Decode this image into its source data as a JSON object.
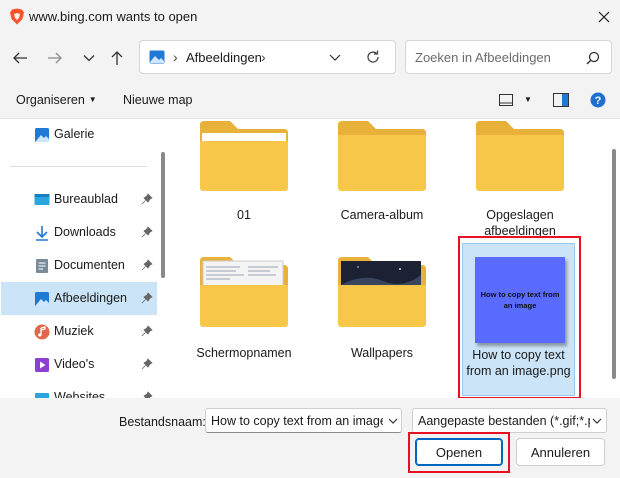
{
  "window": {
    "title": "www.bing.com wants to open",
    "close_icon": "close-icon",
    "app_icon": "brave-lion-icon"
  },
  "navigation": {
    "back_icon": "arrow-left-icon",
    "forward_icon": "arrow-right-icon",
    "recent_icon": "chevron-down-icon",
    "up_icon": "arrow-up-icon",
    "address_icon": "pictures-icon",
    "address_crumb": "Afbeeldingen",
    "refresh_icon": "refresh-icon",
    "search_placeholder": "Zoeken in Afbeeldingen",
    "search_icon": "search-icon"
  },
  "toolbar": {
    "organize_label": "Organiseren",
    "new_folder_label": "Nieuwe map"
  },
  "sidebar": {
    "items": [
      {
        "label": "Galerie",
        "icon": "gallery-icon",
        "pinned": false,
        "selected": false
      },
      {
        "label": "Bureaublad",
        "icon": "desktop-icon",
        "pinned": true,
        "selected": false
      },
      {
        "label": "Downloads",
        "icon": "download-icon",
        "pinned": true,
        "selected": false
      },
      {
        "label": "Documenten",
        "icon": "documents-icon",
        "pinned": true,
        "selected": false
      },
      {
        "label": "Afbeeldingen",
        "icon": "pictures-icon",
        "pinned": true,
        "selected": true
      },
      {
        "label": "Muziek",
        "icon": "music-icon",
        "pinned": true,
        "selected": false
      },
      {
        "label": "Video's",
        "icon": "videos-icon",
        "pinned": true,
        "selected": false
      },
      {
        "label": "Websites",
        "icon": "folder-icon",
        "pinned": true,
        "selected": false
      }
    ]
  },
  "files": [
    {
      "label": "01",
      "type": "folder"
    },
    {
      "label": "Camera-album",
      "type": "folder"
    },
    {
      "label": "Opgeslagen afbeeldingen",
      "type": "folder"
    },
    {
      "label": "Schermopnamen",
      "type": "folder"
    },
    {
      "label": "Wallpapers",
      "type": "folder"
    },
    {
      "label": "How to copy text from an image.png",
      "type": "image",
      "thumbnail_text": "How to copy text from an image",
      "selected": true
    }
  ],
  "bottom": {
    "filename_label": "Bestandsnaam:",
    "filename_value": "How to copy text from an image",
    "filetype_value": "Aangepaste bestanden (*.gif;*.p",
    "open_label": "Openen",
    "cancel_label": "Annuleren"
  },
  "colors": {
    "accent": "#0067c0",
    "selection": "#cce4f7",
    "highlight": "#e81123",
    "thumbnail": "#5a6bff"
  }
}
